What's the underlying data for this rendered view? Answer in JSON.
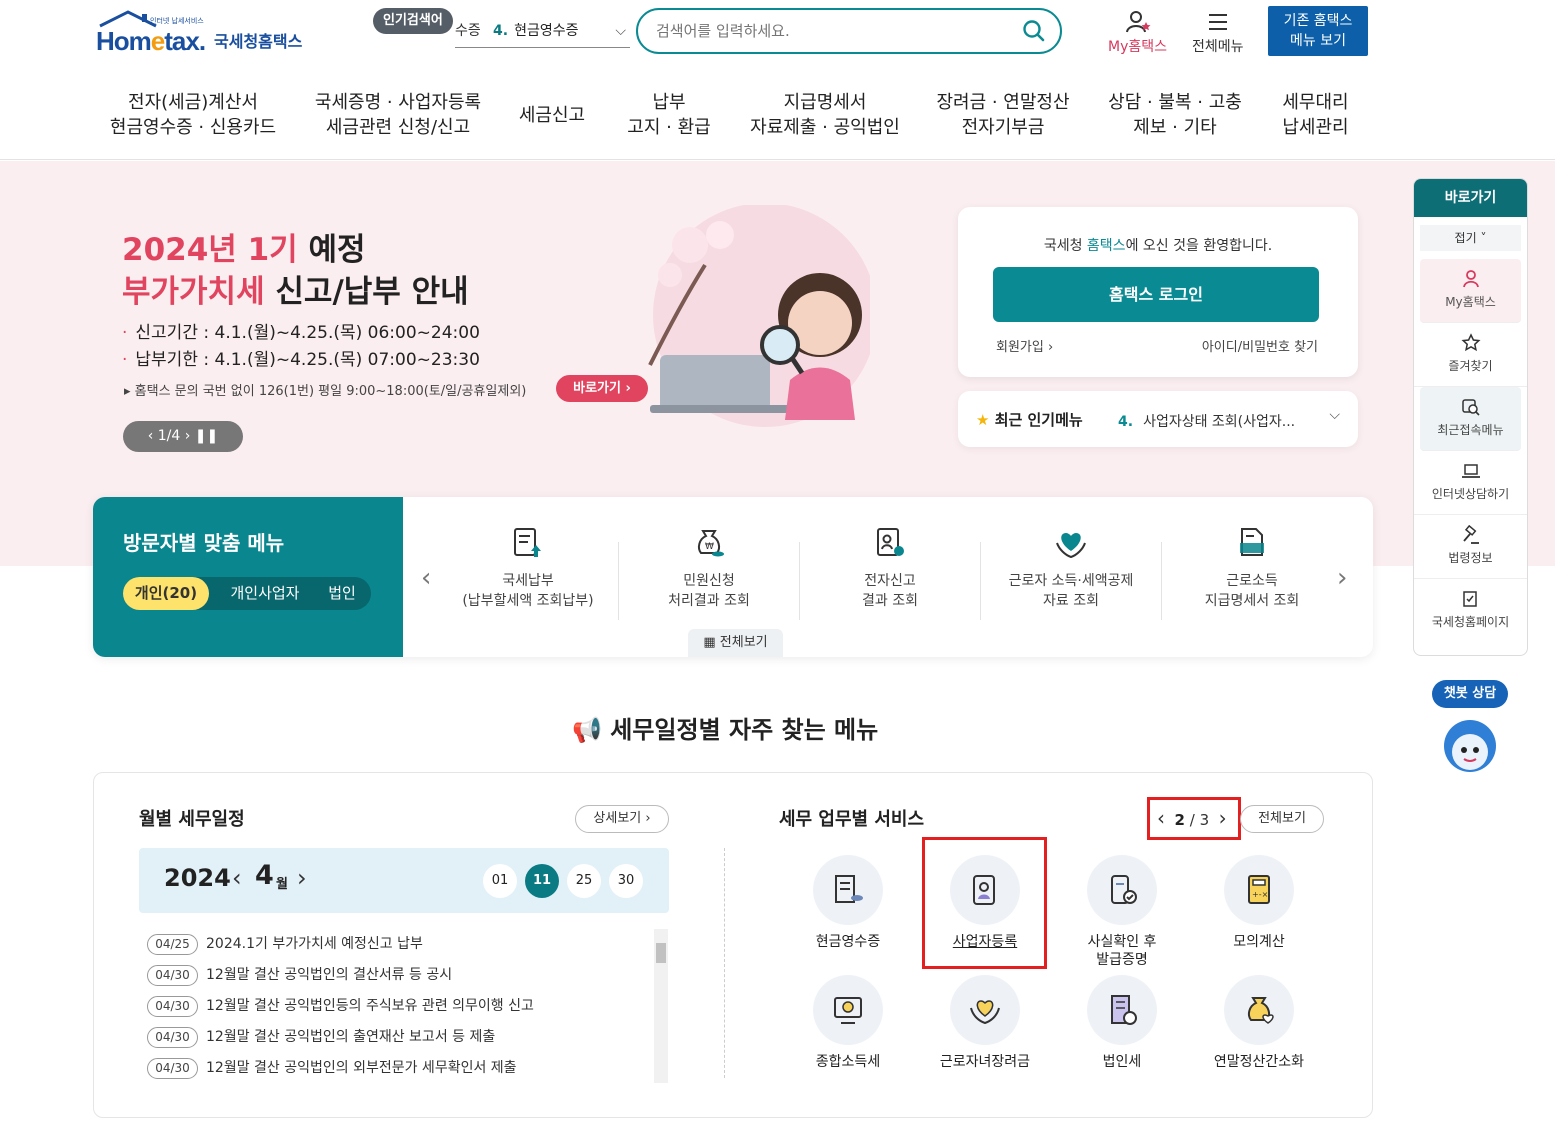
{
  "header": {
    "logo_sub": "인터넷 납세서비스",
    "logo_home": "Hometax.",
    "logo_kr": "국세청홈택스",
    "popular_badge": "인기검색어",
    "popular_prev": "수증",
    "popular_num": "4.",
    "popular_term": "현금영수증",
    "search_placeholder": "검색어를 입력하세요.",
    "my_home": "My홈택스",
    "all_menu": "전체메뉴",
    "old_home_1": "기존 홈택스",
    "old_home_2": "메뉴 보기"
  },
  "gnb": [
    {
      "l1": "전자(세금)계산서",
      "l2": "현금영수증 · 신용카드"
    },
    {
      "l1": "국세증명 · 사업자등록",
      "l2": "세금관련 신청/신고"
    },
    {
      "l1": "세금신고",
      "l2": ""
    },
    {
      "l1": "납부",
      "l2": "고지 · 환급"
    },
    {
      "l1": "지급명세서",
      "l2": "자료제출 · 공익법인"
    },
    {
      "l1": "장려금 · 연말정산",
      "l2": "전자기부금"
    },
    {
      "l1": "상담 · 불복 · 고충",
      "l2": "제보 · 기타"
    },
    {
      "l1": "세무대리",
      "l2": "납세관리"
    }
  ],
  "banner": {
    "t1_pink": "2024년 1기",
    "t1_rest": " 예정",
    "t2_pink": "부가가치세",
    "t2_rest": " 신고/납부 안내",
    "line1_label": "신고기간 : ",
    "line1_value": "4.1.(월)~4.25.(목) 06:00~24:00",
    "line2_label": "납부기한 : ",
    "line2_value": "4.1.(월)~4.25.(목) 07:00~23:30",
    "note": "▸ 홈택스 문의 국번 없이 126(1번) 평일 9:00~18:00(토/일/공휴일제외)",
    "go": "바로가기 ›",
    "pager": "‹  1/4  ›   ❚❚"
  },
  "login": {
    "welcome_pre": "국세청 ",
    "welcome_hl": "홈택스",
    "welcome_post": "에 오신 것을 환영합니다.",
    "login_btn": "홈택스 로그인",
    "join": "회원가입 ›",
    "find": "아이디/비밀번호 찾기"
  },
  "recent": {
    "label": "최근 인기메뉴",
    "num": "4.",
    "value": "사업자상태 조회(사업자..."
  },
  "quick": {
    "title": "바로가기",
    "fold": "접기 ˅",
    "items": [
      "My홈택스",
      "즐겨찾기",
      "최근접속메뉴",
      "인터넷상담하기",
      "법령정보",
      "국세청홈페이지"
    ]
  },
  "chatbot": {
    "label": "챗봇 상담"
  },
  "visitor": {
    "title": "방문자별 맞춤 메뉴",
    "tabs": [
      "개인(20)",
      "개인사업자",
      "법인"
    ],
    "items": [
      {
        "l1": "국세납부",
        "l2": "(납부할세액 조회납부)"
      },
      {
        "l1": "민원신청",
        "l2": "처리결과 조회"
      },
      {
        "l1": "전자신고",
        "l2": "결과 조회"
      },
      {
        "l1": "근로자 소득·세액공제",
        "l2": "자료 조회"
      },
      {
        "l1": "근로소득",
        "l2": "지급명세서 조회"
      }
    ],
    "all": "전체보기"
  },
  "section_title": "세무일정별 자주 찾는 메뉴",
  "calendar": {
    "title": "월별 세무일정",
    "detail": "상세보기 ›",
    "year": "2024",
    "month": "4",
    "month_unit": "월",
    "days": [
      "01",
      "11",
      "25",
      "30"
    ],
    "selected_day": "11",
    "events": [
      {
        "date": "04/25",
        "text": "2024.1기 부가가치세 예정신고 납부"
      },
      {
        "date": "04/30",
        "text": "12월말 결산 공익법인의 결산서류 등 공시"
      },
      {
        "date": "04/30",
        "text": "12월말 결산 공익법인등의 주식보유 관련 의무이행 신고"
      },
      {
        "date": "04/30",
        "text": "12월말 결산 공익법인의 출연재산 보고서 등 제출"
      },
      {
        "date": "04/30",
        "text": "12월말 결산 공익법인의 외부전문가 세무확인서 제출"
      }
    ]
  },
  "services": {
    "title": "세무 업무별 서비스",
    "page_current": "2",
    "page_total": "3",
    "all": "전체보기",
    "items": [
      {
        "l1": "현금영수증",
        "l2": ""
      },
      {
        "l1": "사업자등록",
        "l2": ""
      },
      {
        "l1": "사실확인 후",
        "l2": "발급증명"
      },
      {
        "l1": "모의계산",
        "l2": ""
      },
      {
        "l1": "종합소득세",
        "l2": ""
      },
      {
        "l1": "근로자녀장려금",
        "l2": ""
      },
      {
        "l1": "법인세",
        "l2": ""
      },
      {
        "l1": "연말정산간소화",
        "l2": ""
      }
    ]
  },
  "colors": {
    "teal": "#0a868e",
    "pink": "#e0445e",
    "highlight_red": "#e41f1f",
    "navy": "#0c5fa8"
  }
}
